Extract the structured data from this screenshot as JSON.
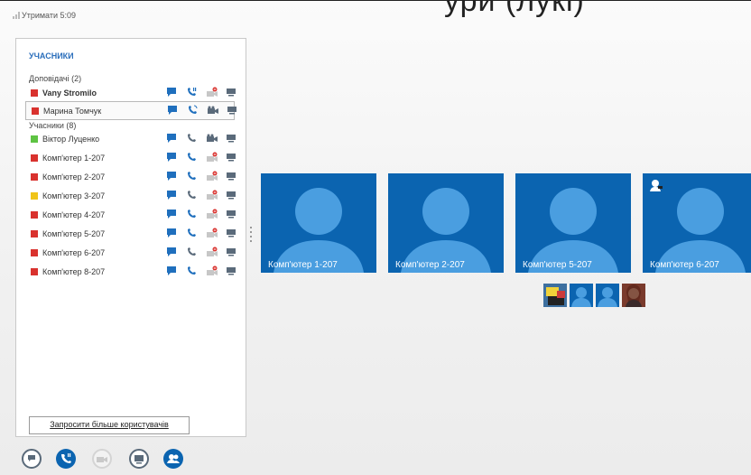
{
  "caption_fragment": "ури (лукі)",
  "top_bar": {
    "hold_label": "Утримати 5:09"
  },
  "panel": {
    "title": "УЧАСНИКИ",
    "presenters_header": "Доповідачі (2)",
    "attendees_header": "Учасники (8)",
    "presenters": [
      {
        "name": "Vany Stromilo",
        "status_color": "#d9322e",
        "bold": true
      },
      {
        "name": "Марина Томчук",
        "status_color": "#d9322e",
        "bold": false
      }
    ],
    "attendees": [
      {
        "name": "Віктор Луценко",
        "status_color": "#5ec343"
      },
      {
        "name": "Комп'ютер 1-207",
        "status_color": "#d9322e"
      },
      {
        "name": "Комп'ютер 2-207",
        "status_color": "#d9322e"
      },
      {
        "name": "Комп'ютер 3-207",
        "status_color": "#f0c419"
      },
      {
        "name": "Комп'ютер 4-207",
        "status_color": "#d9322e"
      },
      {
        "name": "Комп'ютер 5-207",
        "status_color": "#d9322e"
      },
      {
        "name": "Комп'ютер 6-207",
        "status_color": "#d9322e"
      },
      {
        "name": "Комп'ютер 8-207",
        "status_color": "#d9322e"
      }
    ],
    "invite_button": "Запросити більше користувачів"
  },
  "video_tiles": [
    {
      "label": "Комп'ютер 1-207"
    },
    {
      "label": "Комп'ютер 2-207"
    },
    {
      "label": "Комп'ютер 5-207"
    },
    {
      "label": "Комп'ютер 6-207"
    }
  ],
  "bottom_toolbar": [
    {
      "icon": "chat-icon"
    },
    {
      "icon": "call-icon"
    },
    {
      "icon": "video-icon"
    },
    {
      "icon": "present-icon"
    },
    {
      "icon": "participants-icon"
    }
  ],
  "colors": {
    "accent": "#0b64b0",
    "title_blue": "#2a6ebb"
  }
}
